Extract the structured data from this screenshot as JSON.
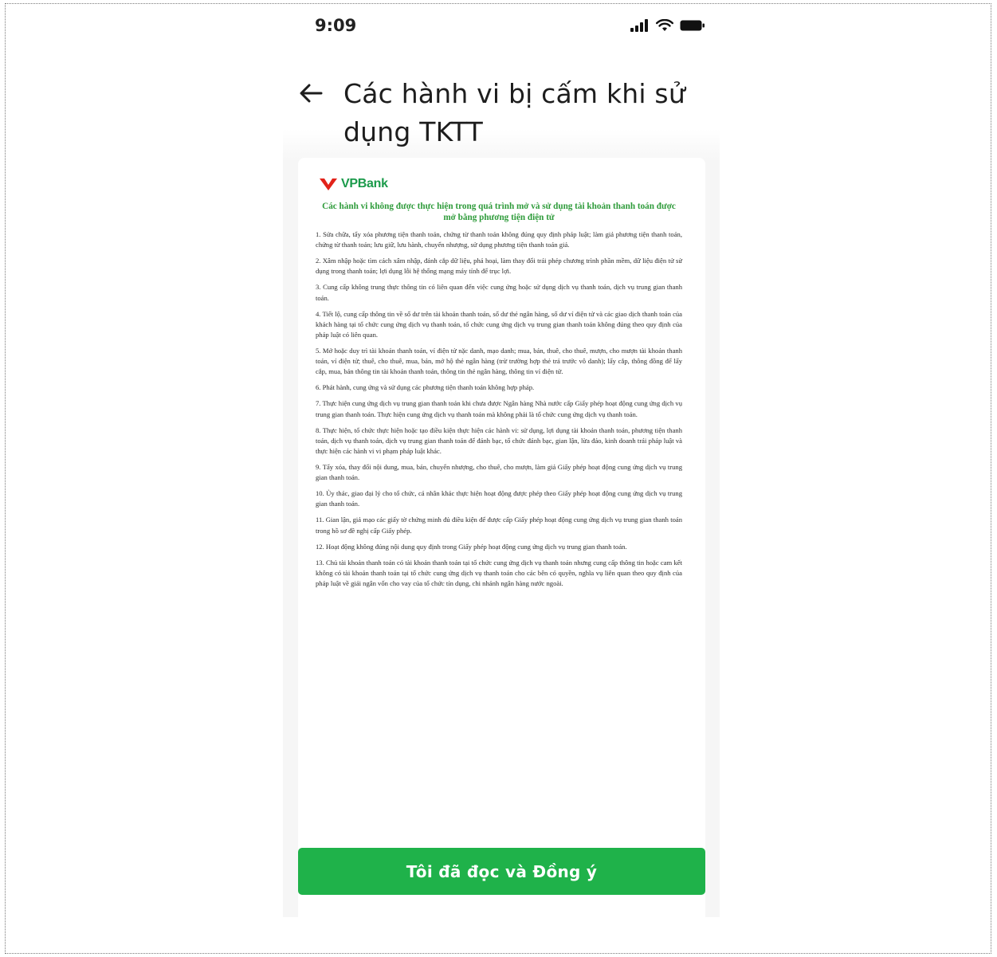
{
  "status_bar": {
    "time": "9:09",
    "icons": [
      "signal-icon",
      "wifi-icon",
      "battery-icon"
    ]
  },
  "header": {
    "back_icon": "arrow-left-icon",
    "title": "Các hành vi bị cấm khi sử dụng TKTT"
  },
  "document": {
    "logo_text": "VPBank",
    "heading": "Các hành vi không được thực hiện trong quá trình mở và sử dụng tài khoản thanh toán được mở bằng phương tiện điện tử",
    "clauses": [
      "1. Sửa chữa, tẩy xóa phương tiện thanh toán, chứng từ thanh toán không đúng quy định pháp luật; làm giả phương tiện thanh toán, chứng từ thanh toán; lưu giữ, lưu hành, chuyển nhượng, sử dụng phương tiện thanh toán giả.",
      "2. Xâm nhập hoặc tìm cách xâm nhập, đánh cắp dữ liệu, phá hoại, làm thay đổi trái phép chương trình phần mềm, dữ liệu điện tử sử dụng trong thanh toán; lợi dụng lỗi hệ thống mạng máy tính để trục lợi.",
      "3. Cung cấp không trung thực thông tin có liên quan đến việc cung ứng hoặc sử dụng dịch vụ thanh toán, dịch vụ trung gian thanh toán.",
      "4. Tiết lộ, cung cấp thông tin về số dư trên tài khoản thanh toán, số dư thẻ ngân hàng, số dư ví điện tử và các giao dịch thanh toán của khách hàng tại tổ chức cung ứng dịch vụ thanh toán, tổ chức cung ứng dịch vụ trung gian thanh toán không đúng theo quy định của pháp luật có liên quan.",
      "5. Mở hoặc duy trì tài khoản thanh toán, ví điện tử nặc danh, mạo danh; mua, bán, thuê, cho thuê, mượn, cho mượn tài khoản thanh toán, ví điện tử; thuê, cho thuê, mua, bán, mở hộ thẻ ngân hàng (trừ trường hợp thẻ trả trước vô danh); lấy cắp, thông đồng để lấy cắp, mua, bán thông tin tài khoản thanh toán, thông tin thẻ ngân hàng, thông tin ví điện tử.",
      "6. Phát hành, cung ứng và sử dụng các phương tiện thanh toán không hợp pháp.",
      "7. Thực hiện cung ứng dịch vụ trung gian thanh toán khi chưa được Ngân hàng Nhà nước cấp Giấy phép hoạt động cung ứng dịch vụ trung gian thanh toán. Thực hiện cung ứng dịch vụ thanh toán mà không phải là tổ chức cung ứng dịch vụ thanh toán.",
      "8. Thực hiện, tổ chức thực hiện hoặc tạo điều kiện thực hiện các hành vi: sử dụng, lợi dụng tài khoản thanh toán, phương tiện thanh toán, dịch vụ thanh toán, dịch vụ trung gian thanh toán để đánh bạc, tổ chức đánh bạc, gian lận, lừa đảo, kinh doanh trái pháp luật và thực hiện các hành vi vi phạm pháp luật khác.",
      "9. Tẩy xóa, thay đổi nội dung, mua, bán, chuyển nhượng, cho thuê, cho mượn, làm giả Giấy phép hoạt động cung ứng dịch vụ trung gian thanh toán.",
      "10. Ủy thác, giao đại lý cho tổ chức, cá nhân khác thực hiện hoạt động được phép theo Giấy phép hoạt động cung ứng dịch vụ trung gian thanh toán.",
      "11. Gian lận, giả mạo các giấy tờ chứng minh đủ điều kiện để được cấp Giấy phép hoạt động cung ứng dịch vụ trung gian thanh toán trong hồ sơ đề nghị cấp Giấy phép.",
      "12. Hoạt động không đúng nội dung quy định trong Giấy phép hoạt động cung ứng dịch vụ trung gian thanh toán.",
      "13. Chủ tài khoản thanh toán có tài khoản thanh toán tại tổ chức cung ứng dịch vụ thanh toán nhưng cung cấp thông tin hoặc cam kết không có tài khoản thanh toán tại tổ chức cung ứng dịch vụ thanh toán cho các bên có quyền, nghĩa vụ liên quan theo quy định của pháp luật về giải ngân vốn cho vay của tổ chức tín dụng, chi nhánh ngân hàng nước ngoài."
    ]
  },
  "footer": {
    "agree_button_label": "Tôi đã đọc và Đồng ý"
  },
  "colors": {
    "brand_green": "#1fb24a",
    "heading_green": "#2e9b3a",
    "logo_red": "#e2231a"
  }
}
